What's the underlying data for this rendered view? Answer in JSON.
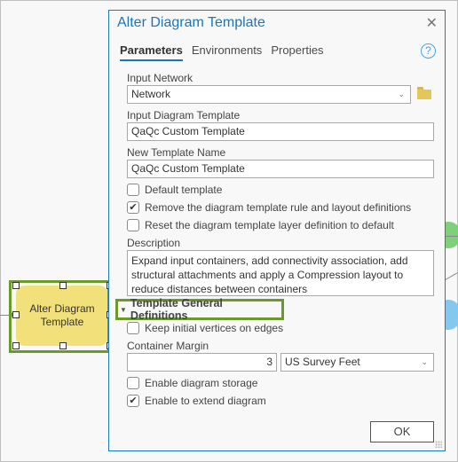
{
  "canvas": {
    "node_label": "Alter Diagram Template",
    "colors": {
      "node_fill": "#f2e07a",
      "selection": "#6a9a28",
      "green_node": "#7fd07a",
      "blue_node": "#84c8f0"
    }
  },
  "dialog": {
    "title": "Alter Diagram Template",
    "close_icon": "close-icon",
    "help_icon": "?",
    "tabs": [
      {
        "label": "Parameters",
        "active": true
      },
      {
        "label": "Environments",
        "active": false
      },
      {
        "label": "Properties",
        "active": false
      }
    ],
    "input_network": {
      "label": "Input Network",
      "value": "Network"
    },
    "input_template": {
      "label": "Input Diagram Template",
      "value": "QaQc Custom Template"
    },
    "new_template_name": {
      "label": "New Template Name",
      "value": "QaQc Custom Template"
    },
    "checkboxes": [
      {
        "label": "Default template",
        "checked": false
      },
      {
        "label": "Remove the diagram template rule and layout definitions",
        "checked": true
      },
      {
        "label": "Reset the diagram template layer definition to default",
        "checked": false
      }
    ],
    "description": {
      "label": "Description",
      "value": "Expand input containers, add connectivity association, add structural attachments and apply a Compression layout to reduce distances between containers"
    },
    "section": {
      "title": "Template General Definitions",
      "keep_vertices": {
        "label": "Keep initial vertices on edges",
        "checked": false
      },
      "container_margin": {
        "label": "Container Margin",
        "value": "3",
        "unit": "US Survey Feet"
      },
      "enable_storage": {
        "label": "Enable diagram storage",
        "checked": false
      },
      "enable_extend": {
        "label": "Enable to extend diagram",
        "checked": true
      }
    },
    "ok_label": "OK",
    "accent": "#1b75b8"
  }
}
